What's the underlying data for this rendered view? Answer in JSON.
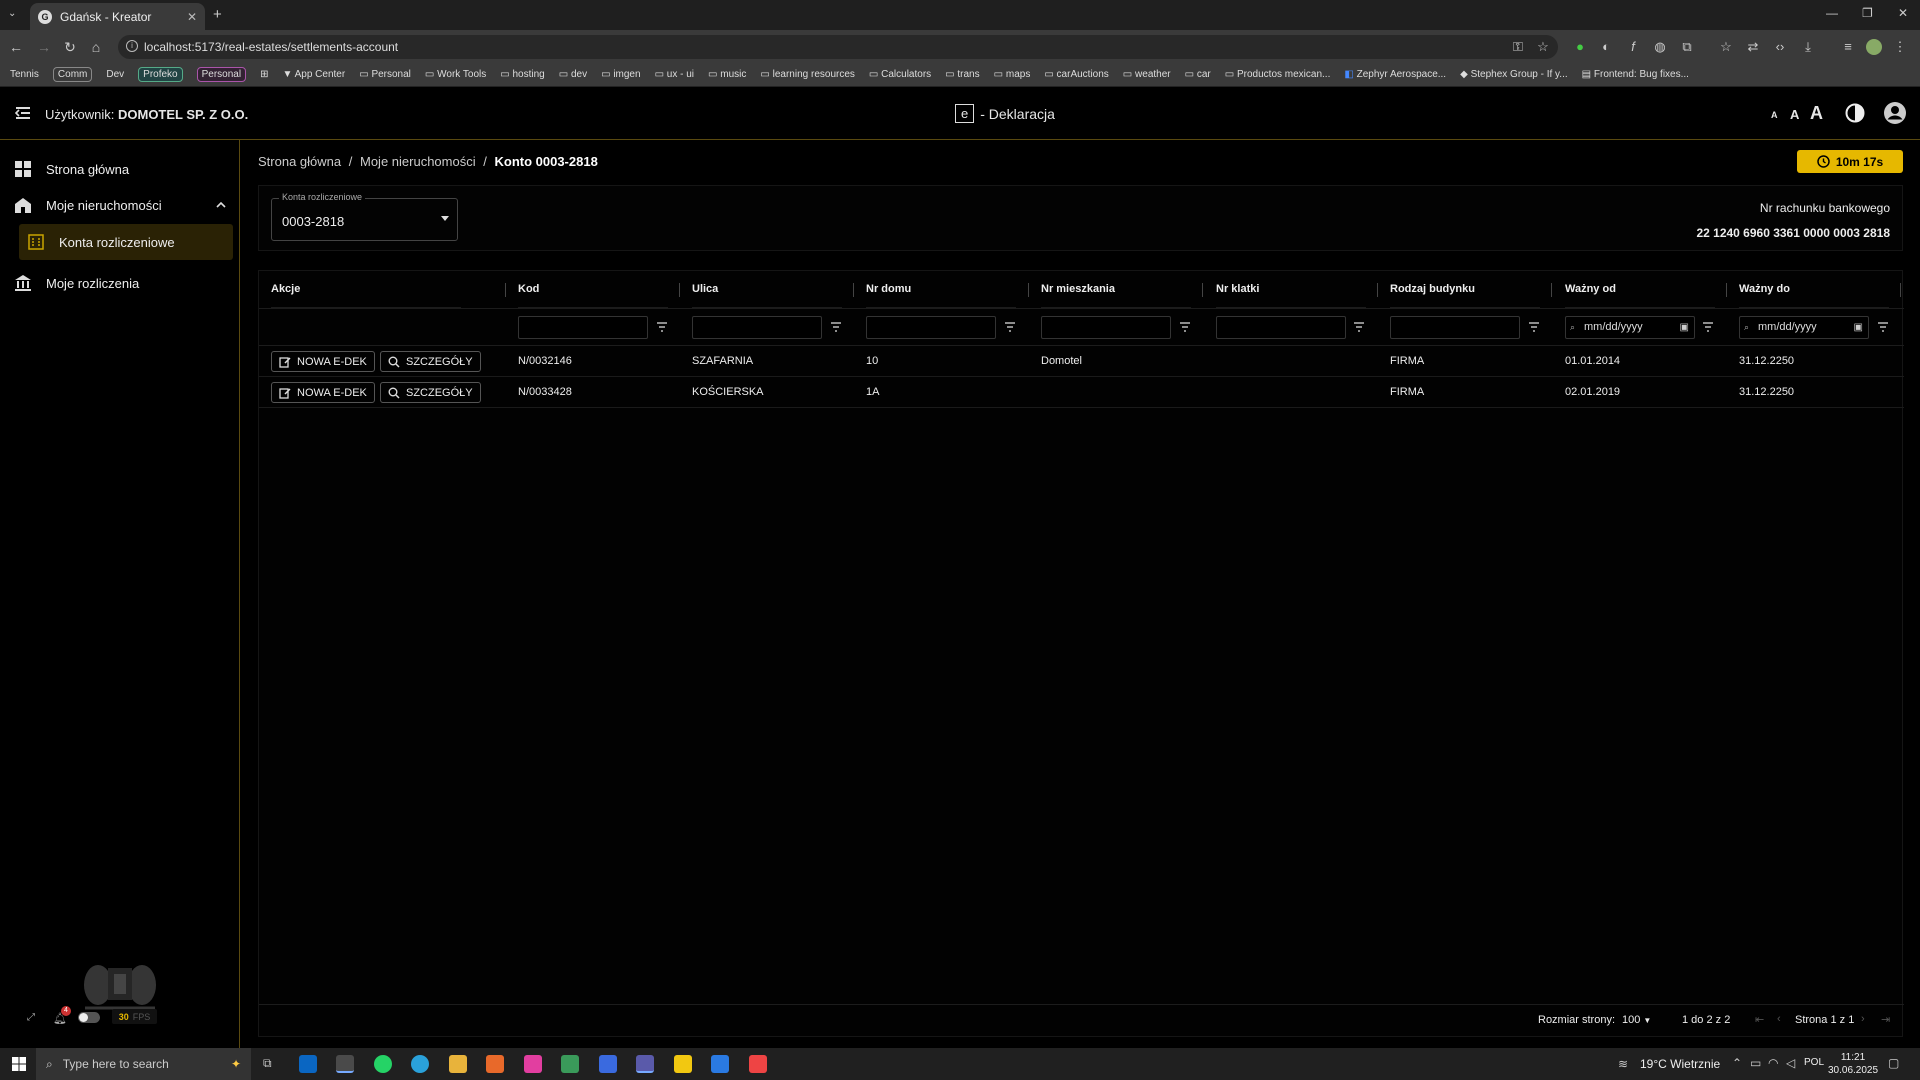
{
  "browser": {
    "tab_title": "Gdańsk - Kreator",
    "url": "localhost:5173/real-estates/settlements-account",
    "bookmarks": [
      "Tennis",
      "Comm",
      "Dev",
      "Profeko",
      "Personal",
      "App Center",
      "Personal",
      "Work Tools",
      "hosting",
      "dev",
      "imgen",
      "ux - ui",
      "music",
      "learning resources",
      "Calculators",
      "trans",
      "maps",
      "carAuctions",
      "weather",
      "car",
      "Productos mexican...",
      "Zephyr Aerospace...",
      "Stephex Group - If y...",
      "Frontend: Bug fixes..."
    ]
  },
  "header": {
    "user_label": "Użytkownik:",
    "user_name": "DOMOTEL SP. Z O.O.",
    "logo_letter": "e",
    "app_title": "- Deklaracja",
    "font_small": "A",
    "font_medium": "A",
    "font_large": "A"
  },
  "sidebar": {
    "items": [
      {
        "label": "Strona główna"
      },
      {
        "label": "Moje nieruchomości"
      },
      {
        "label": "Konta rozliczeniowe"
      },
      {
        "label": "Moje rozliczenia"
      }
    ],
    "fps_value": "30",
    "fps_label": "FPS",
    "notif_count": "4"
  },
  "breadcrumb": {
    "home": "Strona główna",
    "sep": "/",
    "properties": "Moje nieruchomości",
    "current": "Konto 0003-2818"
  },
  "timer": "10m 17s",
  "account": {
    "label": "Konta rozliczeniowe",
    "value": "0003-2818",
    "bank_label": "Nr rachunku bankowego",
    "bank_number": "22 1240 6960 3361 0000 0003 2818"
  },
  "table": {
    "headers": [
      "Akcje",
      "Kod",
      "Ulica",
      "Nr domu",
      "Nr mieszkania",
      "Nr klatki",
      "Rodzaj budynku",
      "Ważny od",
      "Ważny do"
    ],
    "date_placeholder": "mm/dd/yyyy",
    "new_btn": "NOWA E-DEK",
    "details_btn": "SZCZEGÓŁY",
    "rows": [
      {
        "kod": "N/0032146",
        "ulica": "SZAFARNIA",
        "nr_domu": "10",
        "nr_mieszkania": "Domotel",
        "nr_klatki": "",
        "rodzaj": "FIRMA",
        "od": "01.01.2014",
        "do": "31.12.2250"
      },
      {
        "kod": "N/0033428",
        "ulica": "KOŚCIERSKA",
        "nr_domu": "1A",
        "nr_mieszkania": "",
        "nr_klatki": "",
        "rodzaj": "FIRMA",
        "od": "02.01.2019",
        "do": "31.12.2250"
      }
    ]
  },
  "pager": {
    "size_label": "Rozmiar strony:",
    "size_value": "100",
    "range": "1 do 2 z 2",
    "page": "Strona 1 z 1"
  },
  "taskbar": {
    "search_placeholder": "Type here to search",
    "weather": "19°C  Wietrznie",
    "lang": "POL",
    "time": "11:21",
    "date": "30.06.2025"
  }
}
